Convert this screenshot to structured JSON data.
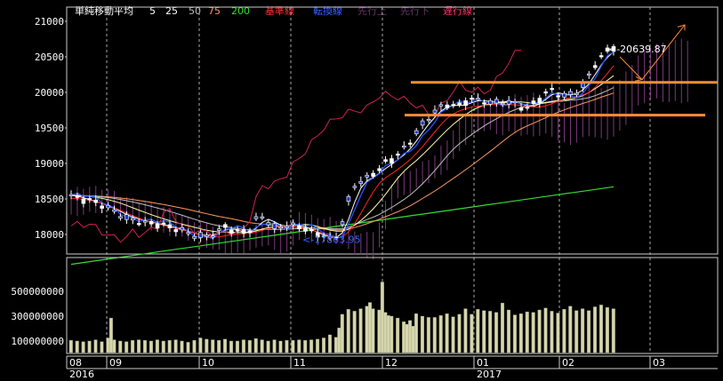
{
  "chart_data": {
    "type": "candlestick",
    "legend": [
      {
        "label": "単純移動平均",
        "color": "#ffffff"
      },
      {
        "label": "5",
        "color": "#ffffff"
      },
      {
        "label": "25",
        "color": "#ffffff"
      },
      {
        "label": "50",
        "color": "#bfbfbf"
      },
      {
        "label": "75",
        "color": "#ff9966"
      },
      {
        "label": "200",
        "color": "#33dd33"
      },
      {
        "label": "基準線",
        "color": "#ff3333"
      },
      {
        "label": "転換線",
        "color": "#3366ff"
      },
      {
        "label": "先行上",
        "color": "#663366"
      },
      {
        "label": "先行下",
        "color": "#663366"
      },
      {
        "label": "遅行線",
        "color": "#ff3366"
      }
    ],
    "price_axis": {
      "ylim": [
        17600,
        21200
      ],
      "ticks": [
        21000,
        20500,
        20000,
        19500,
        19000,
        18500,
        18000
      ]
    },
    "volume_axis": {
      "ylim": [
        0,
        700000000
      ],
      "ticks": [
        500000000,
        300000000,
        100000000
      ]
    },
    "x_labels": [
      "08",
      "09",
      "10",
      "11",
      "12",
      "01",
      "02",
      "03"
    ],
    "year_labels": [
      "2016",
      "2017"
    ],
    "annotations": {
      "high": "20639.87",
      "low": "17863.95"
    },
    "horizontal_lines": [
      {
        "value": 20140,
        "color": "#ff8c3a"
      },
      {
        "value": 19680,
        "color": "#ff8c3a"
      }
    ],
    "series": [
      {
        "name": "SMA 5",
        "color": "#ffffff"
      },
      {
        "name": "SMA 25",
        "color": "#ffffff"
      },
      {
        "name": "SMA 50",
        "color": "#bfbfbf"
      },
      {
        "name": "SMA 75",
        "color": "#ff9966"
      },
      {
        "name": "SMA 200",
        "color": "#33dd33"
      },
      {
        "name": "基準線",
        "color": "#ff3333"
      },
      {
        "name": "転換線",
        "color": "#3366ff"
      },
      {
        "name": "遅行線",
        "color": "#ff3366"
      }
    ],
    "price_shape": [
      [
        0,
        18550
      ],
      [
        6,
        18500
      ],
      [
        12,
        18470
      ],
      [
        18,
        18420
      ],
      [
        24,
        18370
      ],
      [
        30,
        18300
      ],
      [
        36,
        18240
      ],
      [
        42,
        18210
      ],
      [
        48,
        18170
      ],
      [
        54,
        18150
      ],
      [
        60,
        18120
      ],
      [
        66,
        18080
      ],
      [
        72,
        18050
      ],
      [
        78,
        18000
      ],
      [
        84,
        17980
      ],
      [
        90,
        18000
      ],
      [
        96,
        18050
      ],
      [
        100,
        18120
      ],
      [
        104,
        18060
      ],
      [
        108,
        18020
      ],
      [
        112,
        18030
      ],
      [
        116,
        18050
      ],
      [
        120,
        18200
      ],
      [
        124,
        18250
      ],
      [
        128,
        18180
      ],
      [
        132,
        18100
      ],
      [
        136,
        18120
      ],
      [
        140,
        18140
      ],
      [
        144,
        18130
      ],
      [
        148,
        18110
      ],
      [
        152,
        18080
      ],
      [
        156,
        18020
      ],
      [
        160,
        17990
      ],
      [
        164,
        17980
      ],
      [
        168,
        17920
      ],
      [
        172,
        17980
      ],
      [
        176,
        18180
      ],
      [
        180,
        18480
      ],
      [
        184,
        18700
      ],
      [
        188,
        18760
      ],
      [
        192,
        18800
      ],
      [
        196,
        18860
      ],
      [
        200,
        18920
      ],
      [
        204,
        19000
      ],
      [
        208,
        19040
      ],
      [
        212,
        19120
      ],
      [
        216,
        19200
      ],
      [
        220,
        19300
      ],
      [
        224,
        19450
      ],
      [
        228,
        19550
      ],
      [
        232,
        19650
      ],
      [
        236,
        19750
      ],
      [
        240,
        19800
      ],
      [
        244,
        19830
      ],
      [
        248,
        19820
      ],
      [
        252,
        19800
      ],
      [
        256,
        19860
      ],
      [
        260,
        19900
      ],
      [
        264,
        19880
      ],
      [
        268,
        19870
      ],
      [
        272,
        19860
      ],
      [
        276,
        19860
      ],
      [
        280,
        19880
      ],
      [
        284,
        19870
      ],
      [
        288,
        19850
      ],
      [
        292,
        19800
      ],
      [
        296,
        19780
      ],
      [
        300,
        19830
      ],
      [
        304,
        19900
      ],
      [
        308,
        19980
      ],
      [
        312,
        20020
      ],
      [
        316,
        19970
      ],
      [
        320,
        19950
      ],
      [
        324,
        19980
      ],
      [
        328,
        20020
      ],
      [
        332,
        20100
      ],
      [
        336,
        20250
      ],
      [
        340,
        20400
      ],
      [
        344,
        20500
      ],
      [
        348,
        20580
      ],
      [
        352,
        20630
      ]
    ],
    "volume_shape": [
      [
        0,
        1.05
      ],
      [
        4,
        1.0
      ],
      [
        8,
        0.95
      ],
      [
        12,
        1.0
      ],
      [
        16,
        1.1
      ],
      [
        20,
        0.95
      ],
      [
        24,
        1.25
      ],
      [
        26,
        2.85
      ],
      [
        28,
        1.1
      ],
      [
        32,
        1.0
      ],
      [
        36,
        0.95
      ],
      [
        40,
        1.05
      ],
      [
        44,
        1.1
      ],
      [
        48,
        1.05
      ],
      [
        52,
        1.0
      ],
      [
        56,
        1.1
      ],
      [
        60,
        1.0
      ],
      [
        64,
        1.05
      ],
      [
        68,
        1.1
      ],
      [
        72,
        1.0
      ],
      [
        76,
        0.9
      ],
      [
        80,
        1.05
      ],
      [
        84,
        1.25
      ],
      [
        88,
        1.15
      ],
      [
        92,
        1.1
      ],
      [
        96,
        1.05
      ],
      [
        100,
        1.15
      ],
      [
        104,
        1.0
      ],
      [
        108,
        1.0
      ],
      [
        112,
        1.1
      ],
      [
        116,
        1.05
      ],
      [
        120,
        1.2
      ],
      [
        124,
        1.1
      ],
      [
        128,
        1.0
      ],
      [
        132,
        1.1
      ],
      [
        136,
        1.0
      ],
      [
        140,
        1.05
      ],
      [
        144,
        1.05
      ],
      [
        148,
        1.1
      ],
      [
        152,
        1.05
      ],
      [
        156,
        1.1
      ],
      [
        160,
        1.15
      ],
      [
        164,
        1.25
      ],
      [
        168,
        1.5
      ],
      [
        172,
        1.3
      ],
      [
        174,
        2.05
      ],
      [
        176,
        3.15
      ],
      [
        180,
        3.55
      ],
      [
        184,
        3.4
      ],
      [
        188,
        3.6
      ],
      [
        192,
        3.8
      ],
      [
        194,
        4.1
      ],
      [
        196,
        3.6
      ],
      [
        200,
        3.5
      ],
      [
        202,
        5.75
      ],
      [
        204,
        3.3
      ],
      [
        206,
        3.05
      ],
      [
        208,
        3.0
      ],
      [
        212,
        2.85
      ],
      [
        216,
        2.55
      ],
      [
        218,
        2.35
      ],
      [
        220,
        2.65
      ],
      [
        222,
        2.2
      ],
      [
        224,
        3.2
      ],
      [
        228,
        3.0
      ],
      [
        232,
        2.9
      ],
      [
        236,
        2.9
      ],
      [
        240,
        3.05
      ],
      [
        244,
        3.2
      ],
      [
        248,
        2.95
      ],
      [
        252,
        3.15
      ],
      [
        256,
        3.6
      ],
      [
        260,
        3.15
      ],
      [
        264,
        3.55
      ],
      [
        268,
        3.45
      ],
      [
        272,
        3.4
      ],
      [
        276,
        3.3
      ],
      [
        280,
        4.05
      ],
      [
        284,
        3.5
      ],
      [
        288,
        3.1
      ],
      [
        292,
        3.2
      ],
      [
        296,
        3.35
      ],
      [
        300,
        3.3
      ],
      [
        304,
        3.5
      ],
      [
        308,
        3.65
      ],
      [
        312,
        3.4
      ],
      [
        316,
        3.25
      ],
      [
        320,
        3.55
      ],
      [
        324,
        3.8
      ],
      [
        328,
        3.45
      ],
      [
        332,
        3.6
      ],
      [
        336,
        3.45
      ],
      [
        340,
        3.75
      ],
      [
        344,
        3.9
      ],
      [
        348,
        3.7
      ],
      [
        352,
        3.6
      ]
    ]
  }
}
